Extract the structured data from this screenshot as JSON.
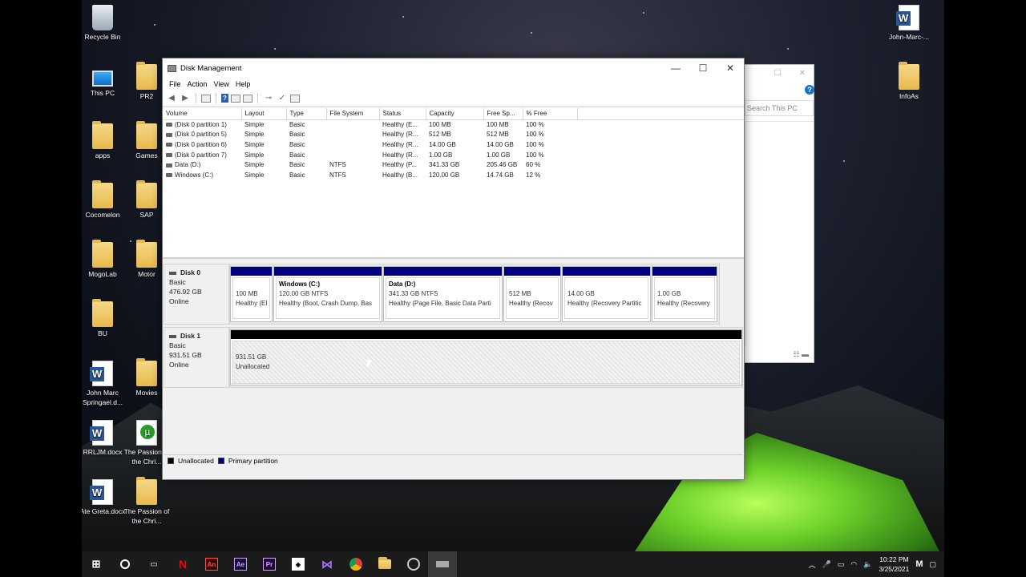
{
  "window": {
    "title": "Disk Management",
    "menu": [
      "File",
      "Action",
      "View",
      "Help"
    ],
    "minimize": "—",
    "maximize": "☐",
    "close": "✕"
  },
  "volume_table": {
    "columns": [
      "Volume",
      "Layout",
      "Type",
      "File System",
      "Status",
      "Capacity",
      "Free Sp...",
      "% Free"
    ],
    "rows": [
      {
        "volume": "(Disk 0 partition 1)",
        "layout": "Simple",
        "type": "Basic",
        "fs": "",
        "status": "Healthy (E...",
        "capacity": "100 MB",
        "free": "100 MB",
        "pct": "100 %"
      },
      {
        "volume": "(Disk 0 partition 5)",
        "layout": "Simple",
        "type": "Basic",
        "fs": "",
        "status": "Healthy (R...",
        "capacity": "512 MB",
        "free": "512 MB",
        "pct": "100 %"
      },
      {
        "volume": "(Disk 0 partition 6)",
        "layout": "Simple",
        "type": "Basic",
        "fs": "",
        "status": "Healthy (R...",
        "capacity": "14.00 GB",
        "free": "14.00 GB",
        "pct": "100 %"
      },
      {
        "volume": "(Disk 0 partition 7)",
        "layout": "Simple",
        "type": "Basic",
        "fs": "",
        "status": "Healthy (R...",
        "capacity": "1.00 GB",
        "free": "1.00 GB",
        "pct": "100 %"
      },
      {
        "volume": "Data (D:)",
        "layout": "Simple",
        "type": "Basic",
        "fs": "NTFS",
        "status": "Healthy (P...",
        "capacity": "341.33 GB",
        "free": "205.46 GB",
        "pct": "60 %"
      },
      {
        "volume": "Windows (C:)",
        "layout": "Simple",
        "type": "Basic",
        "fs": "NTFS",
        "status": "Healthy (B...",
        "capacity": "120.00 GB",
        "free": "14.74 GB",
        "pct": "12 %"
      }
    ]
  },
  "disks": {
    "disk0": {
      "name": "Disk 0",
      "type": "Basic",
      "size": "476.92 GB",
      "state": "Online"
    },
    "disk1": {
      "name": "Disk 1",
      "type": "Basic",
      "size": "931.51 GB",
      "state": "Online"
    }
  },
  "partitions": {
    "p1": {
      "title": "",
      "size": "100 MB",
      "status": "Healthy (EI"
    },
    "p2": {
      "title": "Windows  (C:)",
      "size": "120.00 GB NTFS",
      "status": "Healthy (Boot, Crash Dump, Bas"
    },
    "p3": {
      "title": "Data  (D:)",
      "size": "341.33 GB NTFS",
      "status": "Healthy (Page File, Basic Data Parti"
    },
    "p4": {
      "title": "",
      "size": "512 MB",
      "status": "Healthy (Recov"
    },
    "p5": {
      "title": "",
      "size": "14.00 GB",
      "status": "Healthy (Recovery Partitic"
    },
    "p6": {
      "title": "",
      "size": "1.00 GB",
      "status": "Healthy (Recovery"
    },
    "unalloc": {
      "size": "931.51 GB",
      "status": "Unallocated"
    }
  },
  "legend": {
    "unallocated": "Unallocated",
    "primary": "Primary partition",
    "unallocated_color": "#000000",
    "primary_color": "#000080"
  },
  "explorer": {
    "search_placeholder": "Search This PC",
    "help": "?"
  },
  "desktop_icons": {
    "recycle": "Recycle Bin",
    "thispc": "This PC",
    "pr2": "PR2",
    "apps": "apps",
    "games": "Games",
    "cocomelon": "Cocomelon",
    "sap": "SAP",
    "mogolab": "MogoLab",
    "motor": "Motor",
    "bu": "BU",
    "johnmarc": "John Marc Springael.d...",
    "movies": "Movies",
    "rrljm": "RRLJM.docx",
    "passion1": "The Passion of the Chri...",
    "ategreta": "Ate Greta.docx",
    "passion2": "The Passion of the Chri...",
    "johnmarc_right": "John-Marc-...",
    "infoas": "InfoAs"
  },
  "taskbar": {
    "time": "10:22 PM",
    "date": "3/25/2021"
  }
}
